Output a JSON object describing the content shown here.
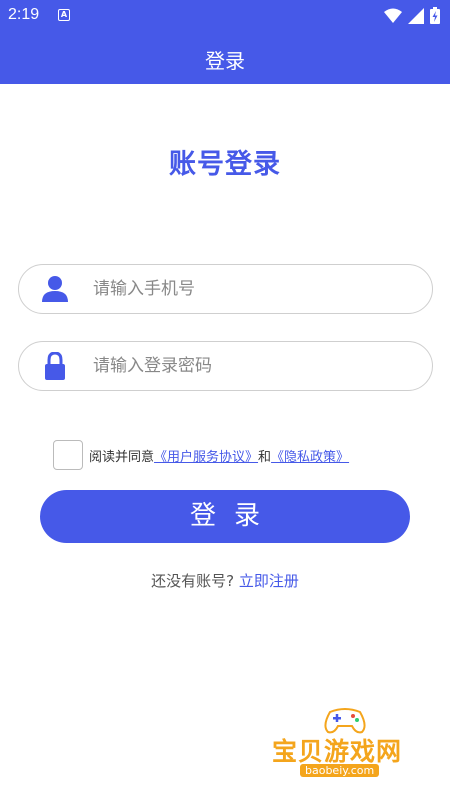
{
  "status_bar": {
    "time": "2:19",
    "notification_badge": "A",
    "icons": [
      "wifi-icon",
      "signal-icon",
      "battery-icon"
    ]
  },
  "app_bar": {
    "title": "登录"
  },
  "page_title": "账号登录",
  "phone_field": {
    "icon": "user-icon",
    "placeholder": "请输入手机号",
    "value": ""
  },
  "password_field": {
    "icon": "lock-icon",
    "placeholder": "请输入登录密码",
    "value": ""
  },
  "agreement": {
    "checked": false,
    "prefix": "阅读并同意",
    "terms_link": "《用户服务协议》",
    "conjunction": "和",
    "privacy_link": "《隐私政策》"
  },
  "login_button": {
    "label": "登录"
  },
  "register": {
    "prompt": "还没有账号?",
    "link": "立即注册"
  },
  "watermark": {
    "text": "宝贝游戏网",
    "url": "baobeiy.com"
  },
  "colors": {
    "primary": "#4659e8",
    "border": "#cfcfcf",
    "watermark": "#f4a51c"
  }
}
